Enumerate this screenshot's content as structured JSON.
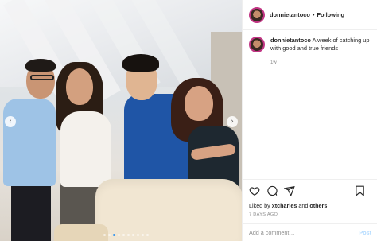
{
  "post": {
    "username": "donnietantoco",
    "follow_label": "Following",
    "separator": "•",
    "caption_text": "A week of catching up with good and true friends",
    "time_ago": "1w",
    "carousel": {
      "dots": 10,
      "active_index": 2
    }
  },
  "actions": {
    "liked_prefix": "Liked by",
    "liked_user": "xtcharles",
    "liked_joiner": "and",
    "liked_others": "others",
    "date": "7 DAYS AGO"
  },
  "comment": {
    "placeholder": "Add a comment…",
    "post_label": "Post"
  },
  "colors": {
    "accent": "#3897f0",
    "ring": "#c13584",
    "post_disabled": "#b3dbff"
  },
  "icons": [
    "chevron-left-icon",
    "chevron-right-icon",
    "heart-icon",
    "comment-icon",
    "share-icon",
    "bookmark-icon"
  ]
}
